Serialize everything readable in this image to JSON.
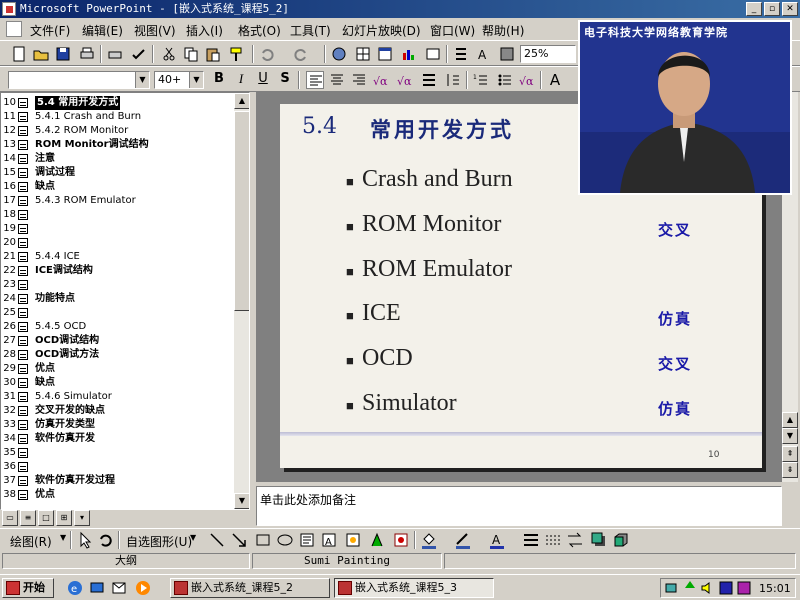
{
  "window": {
    "title": "Microsoft PowerPoint - [嵌入式系统_课程5_2]"
  },
  "menu": [
    "文件(F)",
    "编辑(E)",
    "视图(V)",
    "插入(I)",
    "格式(O)",
    "工具(T)",
    "幻灯片放映(D)",
    "窗口(W)",
    "帮助(H)"
  ],
  "toolbar": {
    "zoom": "25%",
    "font_size": "40+",
    "bold": "B",
    "italic": "I",
    "underline": "U",
    "shadow": "S"
  },
  "outline": [
    {
      "num": "10",
      "text": "5.4   常用开发方式",
      "bold": true,
      "selected": true
    },
    {
      "num": "11",
      "text": "5.4.1   Crash and Burn",
      "bold": false
    },
    {
      "num": "12",
      "text": "5.4.2   ROM Monitor",
      "bold": false
    },
    {
      "num": "13",
      "text": "ROM Monitor调试结构",
      "bold": true
    },
    {
      "num": "14",
      "text": "注意",
      "bold": true
    },
    {
      "num": "15",
      "text": "调试过程",
      "bold": true
    },
    {
      "num": "16",
      "text": "缺点",
      "bold": true
    },
    {
      "num": "17",
      "text": "5.4.3   ROM Emulator",
      "bold": false
    },
    {
      "num": "18",
      "text": "",
      "bold": false
    },
    {
      "num": "19",
      "text": "",
      "bold": false
    },
    {
      "num": "20",
      "text": "",
      "bold": false
    },
    {
      "num": "21",
      "text": "5.4.4   ICE",
      "bold": false
    },
    {
      "num": "22",
      "text": "ICE调试结构",
      "bold": true
    },
    {
      "num": "23",
      "text": "",
      "bold": false
    },
    {
      "num": "24",
      "text": "功能特点",
      "bold": true
    },
    {
      "num": "25",
      "text": "",
      "bold": false
    },
    {
      "num": "26",
      "text": "5.4.5   OCD",
      "bold": false
    },
    {
      "num": "27",
      "text": "OCD调试结构",
      "bold": true
    },
    {
      "num": "28",
      "text": "OCD调试方法",
      "bold": true
    },
    {
      "num": "29",
      "text": "优点",
      "bold": true
    },
    {
      "num": "30",
      "text": "缺点",
      "bold": true
    },
    {
      "num": "31",
      "text": "5.4.6   Simulator",
      "bold": false
    },
    {
      "num": "32",
      "text": "交叉开发的缺点",
      "bold": true
    },
    {
      "num": "33",
      "text": "仿真开发类型",
      "bold": true
    },
    {
      "num": "34",
      "text": "软件仿真开发",
      "bold": true
    },
    {
      "num": "35",
      "text": "",
      "bold": false
    },
    {
      "num": "36",
      "text": "",
      "bold": false
    },
    {
      "num": "37",
      "text": "软件仿真开发过程",
      "bold": true
    },
    {
      "num": "38",
      "text": "优点",
      "bold": true
    }
  ],
  "slide": {
    "number_label": "5.4",
    "title": "常用开发方式",
    "bullets": [
      {
        "text": "Crash and Burn",
        "note": ""
      },
      {
        "text": "ROM Monitor",
        "note": "交叉"
      },
      {
        "text": "ROM Emulator",
        "note": ""
      },
      {
        "text": "ICE",
        "note": "仿真"
      },
      {
        "text": "OCD",
        "note": "交叉"
      },
      {
        "text": "Simulator",
        "note": "仿真"
      }
    ],
    "page_number": "10"
  },
  "notes": {
    "placeholder": "单击此处添加备注"
  },
  "video": {
    "caption": "电子科技大学网络教育学院"
  },
  "drawing_toolbar": {
    "draw_label": "绘图(R)",
    "autoshapes_label": "自选图形(U)"
  },
  "status": {
    "view": "大纲",
    "design": "Sumi Painting"
  },
  "taskbar": {
    "start": "开始",
    "tasks": [
      "嵌入式系统_课程5_2",
      "嵌入式系统_课程5_3"
    ],
    "clock": "15:01"
  }
}
